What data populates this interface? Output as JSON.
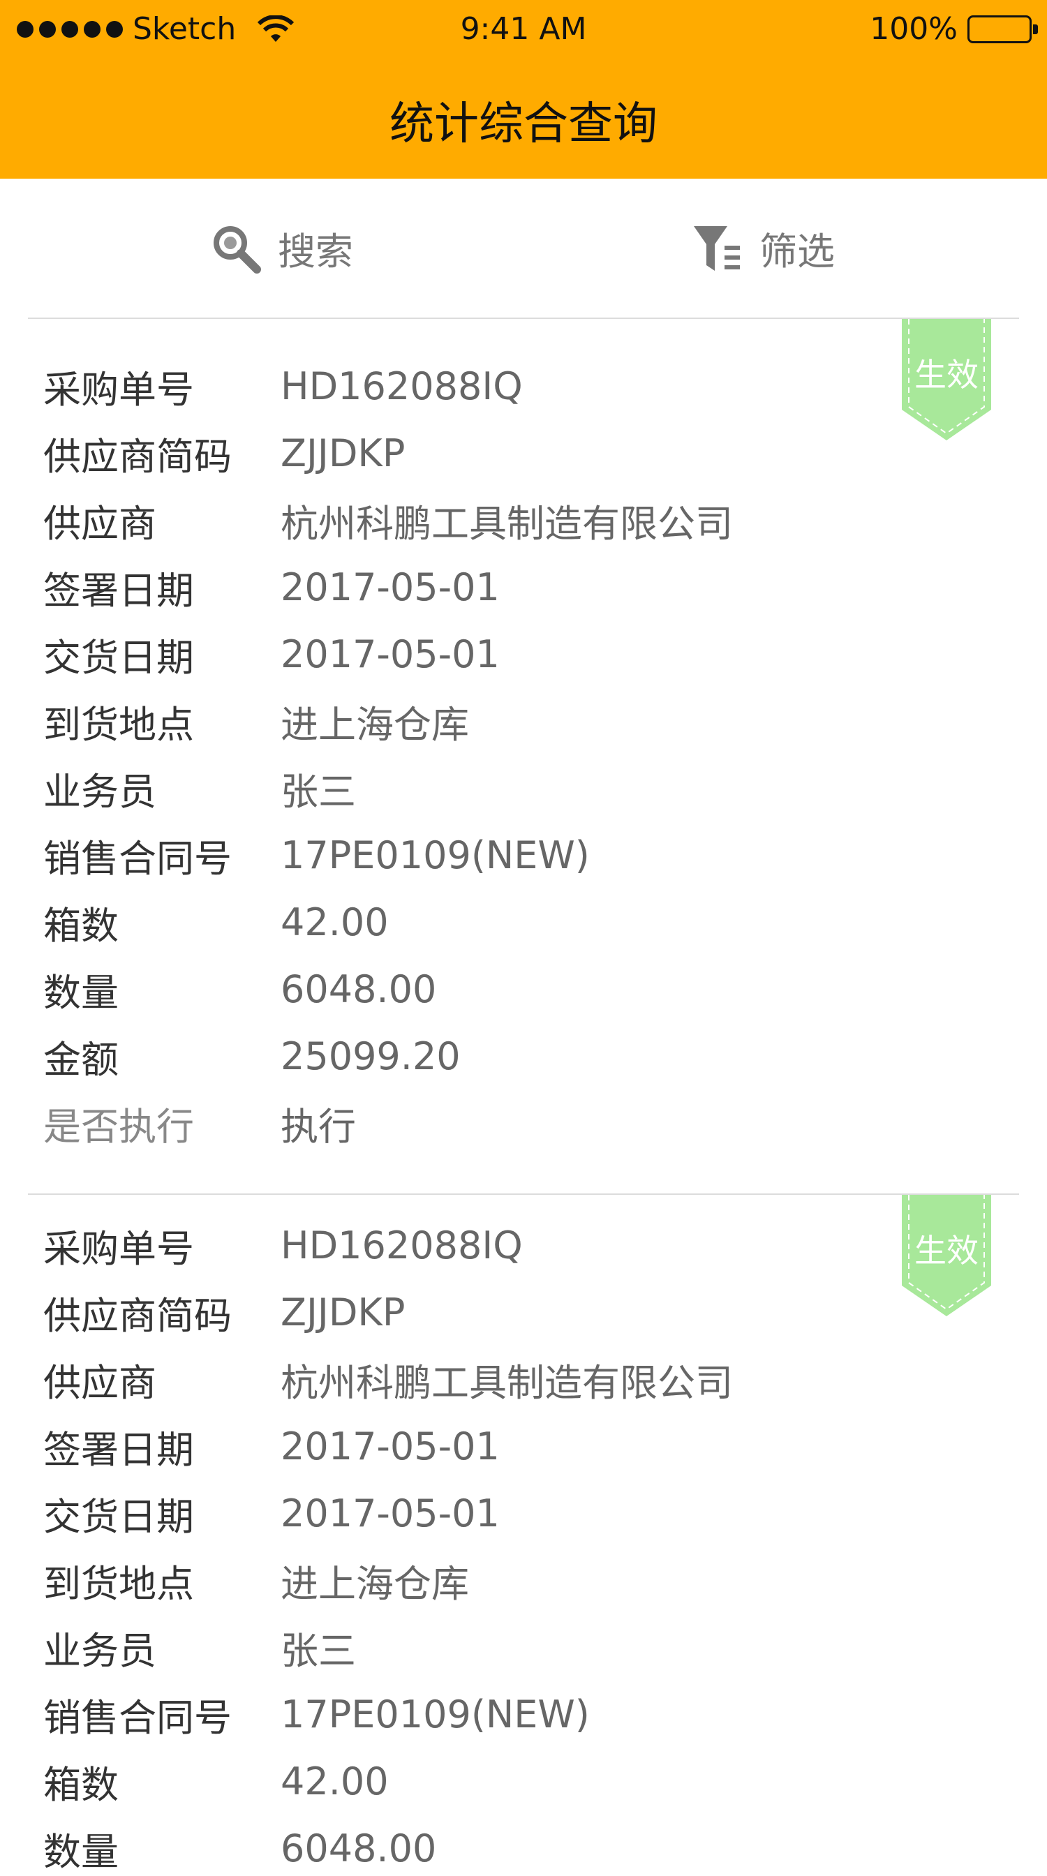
{
  "status_bar": {
    "carrier": "Sketch",
    "time": "9:41 AM",
    "battery": "100%"
  },
  "header": {
    "title": "统计综合查询"
  },
  "toolbar": {
    "search_label": "搜索",
    "filter_label": "筛选"
  },
  "colors": {
    "brand": "#FFAB00",
    "badge": "#A8E89A"
  },
  "records": [
    {
      "status": "生效",
      "fields": [
        {
          "label": "采购单号",
          "value": "HD162088IQ"
        },
        {
          "label": "供应商简码",
          "value": "ZJJDKP"
        },
        {
          "label": "供应商",
          "value": "杭州科鹏工具制造有限公司"
        },
        {
          "label": "签署日期",
          "value": "2017-05-01"
        },
        {
          "label": "交货日期",
          "value": "2017-05-01"
        },
        {
          "label": "到货地点",
          "value": "进上海仓库"
        },
        {
          "label": "业务员",
          "value": "张三"
        },
        {
          "label": "销售合同号",
          "value": "17PE0109(NEW)"
        },
        {
          "label": "箱数",
          "value": "42.00"
        },
        {
          "label": "数量",
          "value": "6048.00"
        },
        {
          "label": "金额",
          "value": "25099.20"
        },
        {
          "label": "是否执行",
          "value": "执行"
        }
      ]
    },
    {
      "status": "生效",
      "fields": [
        {
          "label": "采购单号",
          "value": "HD162088IQ"
        },
        {
          "label": "供应商简码",
          "value": "ZJJDKP"
        },
        {
          "label": "供应商",
          "value": "杭州科鹏工具制造有限公司"
        },
        {
          "label": "签署日期",
          "value": "2017-05-01"
        },
        {
          "label": "交货日期",
          "value": "2017-05-01"
        },
        {
          "label": "到货地点",
          "value": "进上海仓库"
        },
        {
          "label": "业务员",
          "value": "张三"
        },
        {
          "label": "销售合同号",
          "value": "17PE0109(NEW)"
        },
        {
          "label": "箱数",
          "value": "42.00"
        },
        {
          "label": "数量",
          "value": "6048.00"
        }
      ]
    }
  ]
}
